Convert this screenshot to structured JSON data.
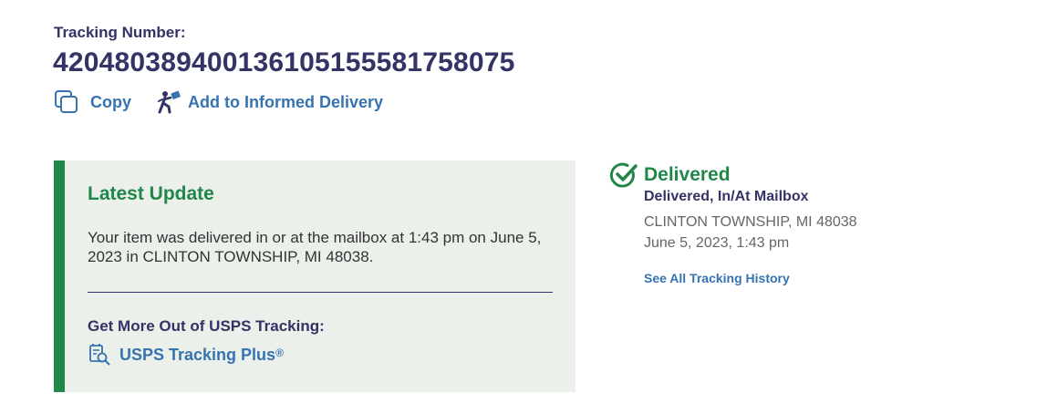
{
  "tracking": {
    "label": "Tracking Number:",
    "number": "420480389400136105155581758075"
  },
  "actions": {
    "copy_label": "Copy",
    "copy_icon": "copy-icon",
    "informed_label": "Add to Informed Delivery",
    "informed_icon": "mail-carrier-icon"
  },
  "latest_update": {
    "title": "Latest Update",
    "text": "Your item was delivered in or at the mailbox at 1:43 pm on June 5, 2023 in CLINTON TOWNSHIP, MI 48038.",
    "more_label": "Get More Out of USPS Tracking:",
    "plus_link_label": "USPS Tracking Plus",
    "plus_link_mark": "®",
    "plus_icon": "tracking-plus-icon"
  },
  "status": {
    "icon": "check-circle-icon",
    "title": "Delivered",
    "subtitle": "Delivered, In/At Mailbox",
    "location": "CLINTON TOWNSHIP, MI 48038",
    "datetime": "June 5, 2023, 1:43 pm",
    "history_link": "See All Tracking History"
  },
  "colors": {
    "navy": "#333366",
    "link_blue": "#3573b1",
    "success_green": "#218748",
    "panel_bg": "#ebf0eb",
    "muted_gray": "#666666"
  }
}
